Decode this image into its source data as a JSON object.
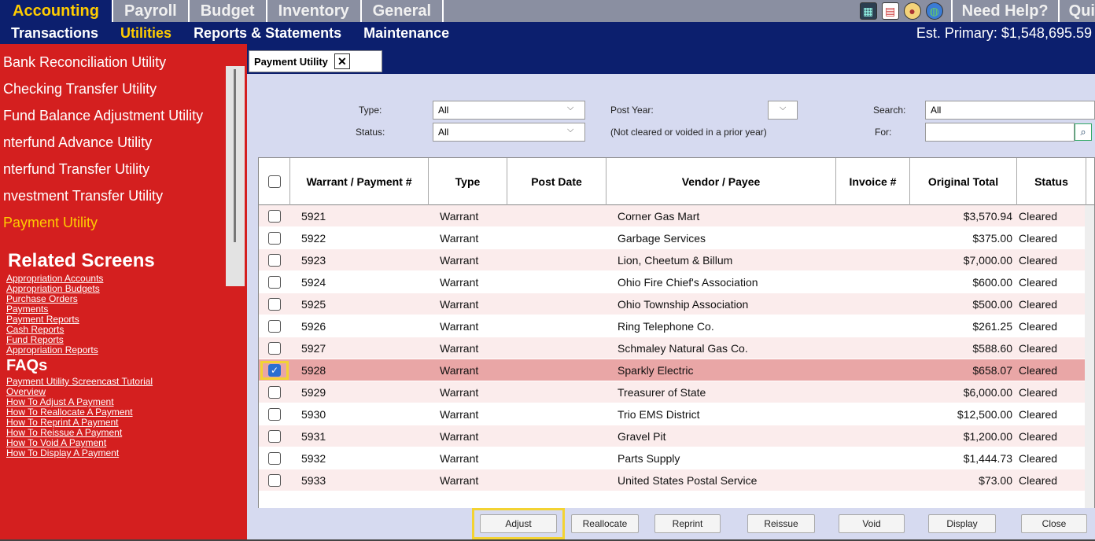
{
  "topnav": {
    "tabs": [
      "Accounting",
      "Payroll",
      "Budget",
      "Inventory",
      "General"
    ],
    "help": "Need Help?",
    "quit": "Qui",
    "icons": [
      "calculator-icon",
      "calendar-icon",
      "palette-icon",
      "globe-icon"
    ]
  },
  "subnav": {
    "items": [
      "Transactions",
      "Utilities",
      "Reports & Statements",
      "Maintenance"
    ],
    "est": "Est. Primary: $1,548,695.59"
  },
  "sidebar": {
    "utilities": [
      "Bank Reconciliation Utility",
      "Checking Transfer Utility",
      "Fund Balance Adjustment Utility",
      "nterfund Advance Utility",
      "nterfund Transfer Utility",
      "nvestment Transfer Utility",
      "Payment Utility"
    ],
    "related_title": "Related Screens",
    "related": [
      "Appropriation Accounts",
      "Appropriation Budgets",
      "Purchase Orders",
      "Payments",
      "Payment Reports",
      "Cash Reports",
      "Fund Reports",
      "Appropriation Reports"
    ],
    "faqs_title": "FAQs",
    "faqs": [
      "Payment Utility Screencast Tutorial",
      "Overview",
      "How To Adjust A Payment",
      "How To Reallocate A Payment",
      "How To Reprint A Payment",
      "How To Reissue A Payment",
      "How To Void A Payment",
      "How To Display A Payment"
    ]
  },
  "panel": {
    "tab_title": "Payment Utility",
    "tab_close": "✕",
    "type_label": "Type:",
    "type_value": "All",
    "status_label": "Status:",
    "status_value": "All",
    "post_year_label": "Post Year:",
    "post_year_value": "",
    "post_year_note": "(Not cleared or voided in a prior year)",
    "search_label": "Search:",
    "search_value": "All",
    "for_label": "For:",
    "for_value": ""
  },
  "grid": {
    "columns": [
      "Warrant / Payment #",
      "Type",
      "Post Date",
      "Vendor / Payee",
      "Invoice #",
      "Original Total",
      "Status"
    ],
    "rows": [
      {
        "num": "5921",
        "type": "Warrant",
        "vendor": "Corner Gas Mart",
        "total": "$3,570.94",
        "status": "Cleared",
        "checked": false
      },
      {
        "num": "5922",
        "type": "Warrant",
        "vendor": "Garbage Services",
        "total": "$375.00",
        "status": "Cleared",
        "checked": false
      },
      {
        "num": "5923",
        "type": "Warrant",
        "vendor": "Lion, Cheetum & Billum",
        "total": "$7,000.00",
        "status": "Cleared",
        "checked": false
      },
      {
        "num": "5924",
        "type": "Warrant",
        "vendor": "Ohio Fire Chief's Association",
        "total": "$600.00",
        "status": "Cleared",
        "checked": false
      },
      {
        "num": "5925",
        "type": "Warrant",
        "vendor": "Ohio Township Association",
        "total": "$500.00",
        "status": "Cleared",
        "checked": false
      },
      {
        "num": "5926",
        "type": "Warrant",
        "vendor": "Ring Telephone Co.",
        "total": "$261.25",
        "status": "Cleared",
        "checked": false
      },
      {
        "num": "5927",
        "type": "Warrant",
        "vendor": "Schmaley Natural Gas Co.",
        "total": "$588.60",
        "status": "Cleared",
        "checked": false
      },
      {
        "num": "5928",
        "type": "Warrant",
        "vendor": "Sparkly Electric",
        "total": "$658.07",
        "status": "Cleared",
        "checked": true
      },
      {
        "num": "5929",
        "type": "Warrant",
        "vendor": "Treasurer of State",
        "total": "$6,000.00",
        "status": "Cleared",
        "checked": false
      },
      {
        "num": "5930",
        "type": "Warrant",
        "vendor": "Trio EMS District",
        "total": "$12,500.00",
        "status": "Cleared",
        "checked": false
      },
      {
        "num": "5931",
        "type": "Warrant",
        "vendor": "Gravel Pit",
        "total": "$1,200.00",
        "status": "Cleared",
        "checked": false
      },
      {
        "num": "5932",
        "type": "Warrant",
        "vendor": "Parts Supply",
        "total": "$1,444.73",
        "status": "Cleared",
        "checked": false
      },
      {
        "num": "5933",
        "type": "Warrant",
        "vendor": "United States Postal Service",
        "total": "$73.00",
        "status": "Cleared",
        "checked": false
      }
    ]
  },
  "footer": {
    "buttons": [
      "Adjust",
      "Reallocate",
      "Reprint",
      "Reissue",
      "Void",
      "Display",
      "Close"
    ]
  }
}
